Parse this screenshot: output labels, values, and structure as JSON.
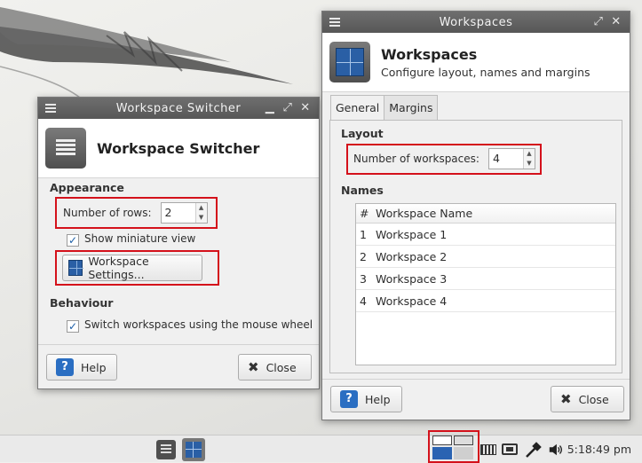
{
  "switcher": {
    "window_title": "Workspace Switcher",
    "title": "Workspace Switcher",
    "appearance_heading": "Appearance",
    "rows_label": "Number of rows:",
    "rows_value": "2",
    "show_miniature_label": "Show miniature view",
    "show_miniature_checked": true,
    "settings_button": "Workspace Settings...",
    "behaviour_heading": "Behaviour",
    "mouse_wheel_label": "Switch workspaces using the mouse wheel",
    "mouse_wheel_checked": true,
    "help_button": "Help",
    "close_button": "Close"
  },
  "workspaces": {
    "window_title": "Workspaces",
    "title": "Workspaces",
    "subtitle": "Configure layout, names and margins",
    "tabs": [
      "General",
      "Margins"
    ],
    "active_tab": "General",
    "layout_heading": "Layout",
    "count_label": "Number of workspaces:",
    "count_value": "4",
    "names_heading": "Names",
    "table": {
      "columns": [
        "#",
        "Workspace Name"
      ],
      "rows": [
        {
          "num": "1",
          "name": "Workspace 1"
        },
        {
          "num": "2",
          "name": "Workspace 2"
        },
        {
          "num": "3",
          "name": "Workspace 3"
        },
        {
          "num": "4",
          "name": "Workspace 4"
        }
      ]
    },
    "help_button": "Help",
    "close_button": "Close"
  },
  "taskbar": {
    "clock": "5:18:49 pm",
    "icons": [
      "window-list-icon",
      "workspace-icon",
      "workspace-switcher-applet",
      "keyboard-icon",
      "battery-icon",
      "network-icon",
      "volume-icon"
    ]
  },
  "colors": {
    "highlight": "#d4111b",
    "accent": "#2a6ec2",
    "titlebar": "#5f5f5f"
  }
}
